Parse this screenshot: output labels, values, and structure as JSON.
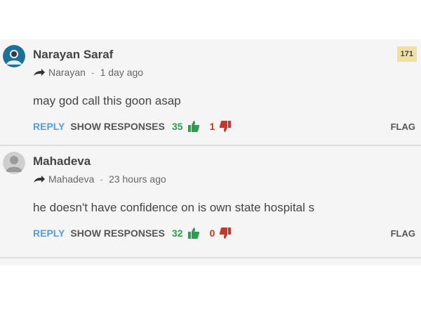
{
  "comments": [
    {
      "author": "Narayan Saraf",
      "reply_to": "Narayan",
      "time": "1 day ago",
      "text": "may god call this goon asap",
      "reply_label": "REPLY",
      "show_responses_label": "SHOW RESPONSES",
      "upvotes": "35",
      "downvotes": "1",
      "flag_label": "FLAG",
      "badge": "171",
      "avatar_icon": "user-avatar-icon"
    },
    {
      "author": "Mahadeva",
      "reply_to": "Mahadeva",
      "time": "23 hours ago",
      "text": "he doesn't have confidence on is own state hospital s",
      "reply_label": "REPLY",
      "show_responses_label": "SHOW RESPONSES",
      "upvotes": "32",
      "downvotes": "0",
      "flag_label": "FLAG",
      "avatar_icon": "default-avatar-icon"
    }
  ],
  "separator": "-",
  "colors": {
    "reply": "#5b9bd5",
    "upvote": "#2e9d4f",
    "downvote": "#c0392b",
    "badge_bg": "#efe0a6",
    "panel_bg": "#f5f5f5"
  }
}
